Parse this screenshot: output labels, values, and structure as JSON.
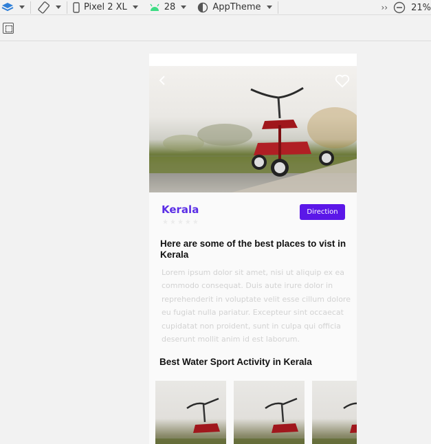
{
  "toolbar": {
    "device": "Pixel 2 XL",
    "api_level": "28",
    "theme": "AppTheme",
    "zoom": "21%",
    "overflow": "››"
  },
  "app": {
    "place_name": "Kerala",
    "rating": 0,
    "rating_max": 5,
    "direction_label": "Direction",
    "heading": "Here are some of the best places to vist in Kerala",
    "description": "Lorem ipsum dolor sit amet, nisi ut aliquip ex ea commodo consequat. Duis aute irure dolor in reprehenderit in voluptate velit esse cillum dolore eu fugiat nulla pariatur. Excepteur sint occaecat cupidatat non proident, sunt in culpa qui officia deserunt mollit anim id est laborum.",
    "section_title": "Best Water Sport Activity in Kerala",
    "activities": [
      {
        "image": "tricycle-image"
      },
      {
        "image": "tricycle-image"
      },
      {
        "image": "tricycle-image"
      }
    ]
  },
  "colors": {
    "accent": "#5b17e8",
    "place_name": "#5b2ee6",
    "body_text": "#d2d2d2"
  }
}
